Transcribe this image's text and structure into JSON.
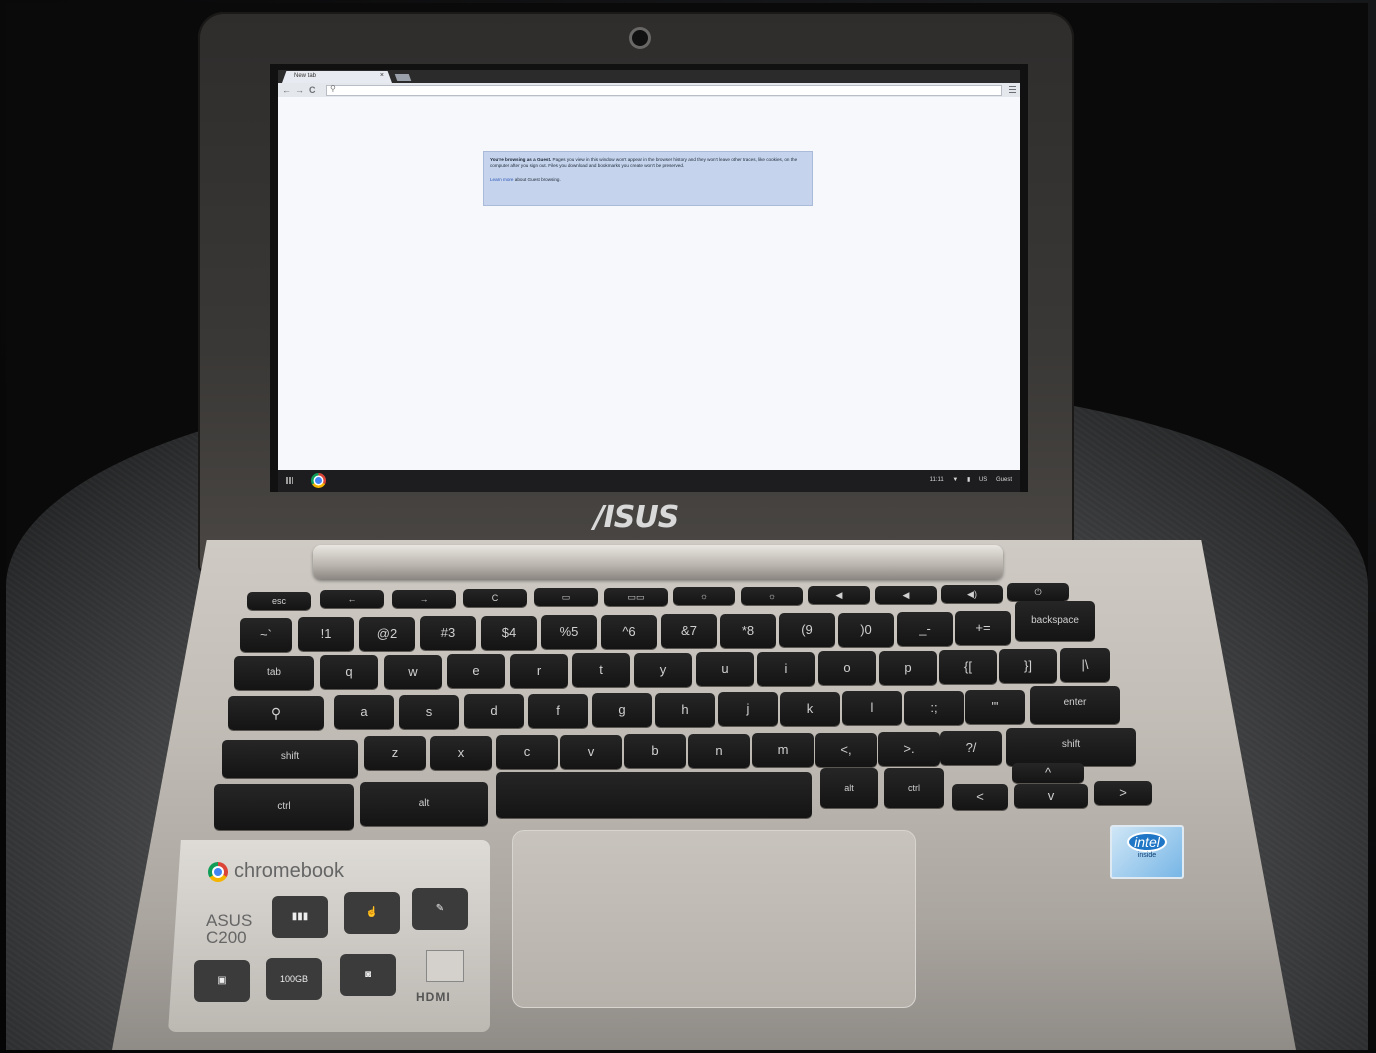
{
  "browser": {
    "tab_title": "New tab",
    "tab_close": "×",
    "nav": {
      "back": "←",
      "forward": "→",
      "reload": "C"
    },
    "omnibox_icon": "search-icon",
    "guest_notice": {
      "heading": "You're browsing as a Guest.",
      "body": "Pages you view in this window won't appear in the browser history and they won't leave other traces, like cookies, on the computer after you sign out. Files you download and bookmarks you create won't be preserved.",
      "link": "Learn more",
      "link_suffix": "about Guest browsing."
    }
  },
  "shelf": {
    "launcher_icon": "app-launcher-icon",
    "pinned_app_icon": "chrome-icon",
    "tray": {
      "time": "11:11",
      "wifi": "wifi-icon",
      "battery": "battery-icon",
      "locale": "US",
      "user": "Guest"
    }
  },
  "lid_brand": "/ISUS",
  "keyboard": {
    "row0": [
      "esc",
      "←",
      "→",
      "C",
      "▭",
      "▭▭",
      "☼",
      "☼",
      "◀",
      "◀",
      "◀)",
      "⏻"
    ],
    "row1": [
      "~`",
      "!1",
      "@2",
      "#3",
      "$4",
      "%5",
      "^6",
      "&7",
      "*8",
      "(9",
      ")0",
      "_-",
      "+=",
      "backspace"
    ],
    "row2": [
      "tab",
      "q",
      "w",
      "e",
      "r",
      "t",
      "y",
      "u",
      "i",
      "o",
      "p",
      "{[",
      "}]",
      "|\\"
    ],
    "row3": [
      "search-icon",
      "a",
      "s",
      "d",
      "f",
      "g",
      "h",
      "j",
      "k",
      "l",
      ":;",
      "\"'",
      "enter"
    ],
    "row4": [
      "shift",
      "z",
      "x",
      "c",
      "v",
      "b",
      "n",
      "m",
      "<,",
      ">.",
      "?/",
      "shift"
    ],
    "row5": [
      "ctrl",
      "alt",
      "",
      "alt",
      "ctrl",
      "<",
      "^",
      "v",
      ">"
    ]
  },
  "chromebook_sticker": {
    "wordmark": "chromebook",
    "model_line1": "ASUS",
    "model_line2": "C200",
    "hdmi": "HDMI",
    "storage": "100GB"
  },
  "intel_sticker": {
    "brand": "intel",
    "sub": "inside"
  }
}
